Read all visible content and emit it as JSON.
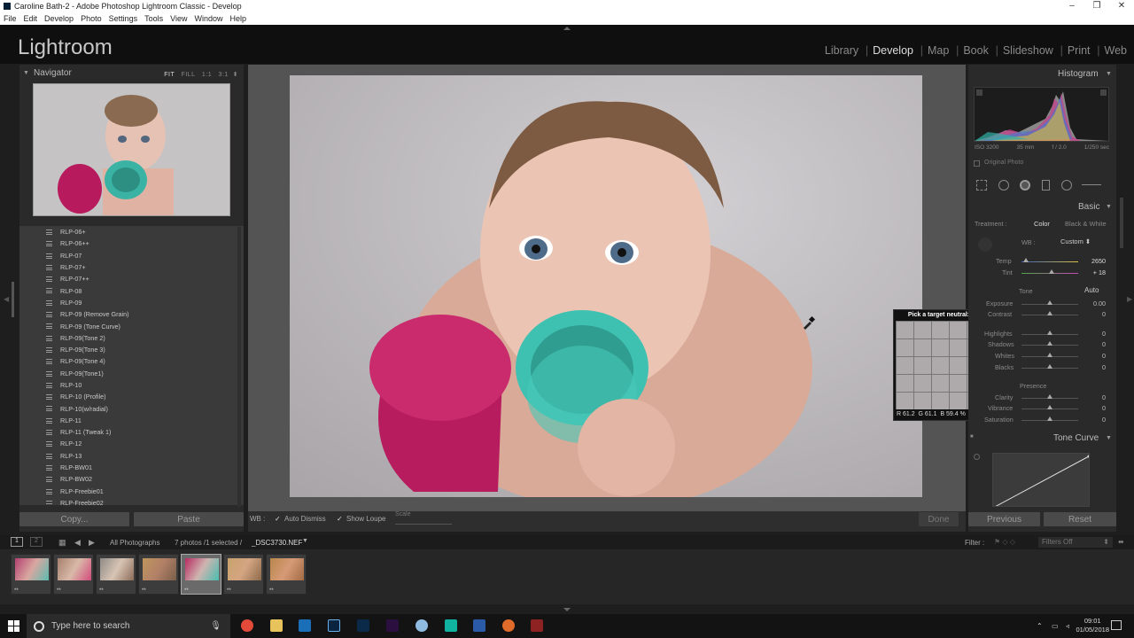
{
  "window": {
    "title": "Caroline Bath-2 - Adobe Photoshop Lightroom Classic - Develop"
  },
  "menu": [
    "File",
    "Edit",
    "Develop",
    "Photo",
    "Settings",
    "Tools",
    "View",
    "Window",
    "Help"
  ],
  "app": {
    "logo": "Lightroom",
    "modules": [
      "Library",
      "Develop",
      "Map",
      "Book",
      "Slideshow",
      "Print",
      "Web"
    ],
    "active_module": "Develop"
  },
  "navigator": {
    "title": "Navigator",
    "modes": [
      "FIT",
      "FILL",
      "1:1",
      "3:1"
    ],
    "active_mode": "FIT"
  },
  "presets": [
    "RLP-06+",
    "RLP-06++",
    "RLP-07",
    "RLP-07+",
    "RLP-07++",
    "RLP-08",
    "RLP-09",
    "RLP-09 (Remove Grain)",
    "RLP-09 (Tone Curve)",
    "RLP-09(Tone 2)",
    "RLP-09(Tone 3)",
    "RLP-09(Tone 4)",
    "RLP-09(Tone1)",
    "RLP-10",
    "RLP-10 (Profile)",
    "RLP-10(w/radial)",
    "RLP-11",
    "RLP-11 (Tweak 1)",
    "RLP-12",
    "RLP-13",
    "RLP-BW01",
    "RLP-BW02",
    "RLP-Freebie01",
    "RLP-Freebie02"
  ],
  "left_buttons": {
    "copy": "Copy...",
    "paste": "Paste"
  },
  "toolbar": {
    "wb": "WB :",
    "auto_dismiss": "Auto Dismiss",
    "show_loupe": "Show Loupe",
    "scale": "Scale",
    "done": "Done"
  },
  "histogram": {
    "title": "Histogram",
    "iso": "ISO 3200",
    "focal": "35 mm",
    "aperture": "f / 2.0",
    "shutter": "1/250 sec",
    "original": "Original Photo"
  },
  "basic": {
    "title": "Basic",
    "treatment_label": "Treatment :",
    "color": "Color",
    "bw": "Black & White",
    "wb_label": "WB :",
    "wb_value": "Custom",
    "temp_label": "Temp",
    "temp_value": "2650",
    "tint_label": "Tint",
    "tint_value": "+ 18",
    "tone_label": "Tone",
    "auto": "Auto",
    "exposure_label": "Exposure",
    "exposure_value": "0.00",
    "contrast_label": "Contrast",
    "contrast_value": "0",
    "highlights_label": "Highlights",
    "highlights_value": "0",
    "shadows_label": "Shadows",
    "shadows_value": "0",
    "whites_label": "Whites",
    "whites_value": "0",
    "blacks_label": "Blacks",
    "blacks_value": "0",
    "presence_label": "Presence",
    "clarity_label": "Clarity",
    "clarity_value": "0",
    "vibrance_label": "Vibrance",
    "vibrance_value": "0",
    "saturation_label": "Saturation",
    "saturation_value": "0"
  },
  "tone_curve": {
    "title": "Tone Curve"
  },
  "right_buttons": {
    "previous": "Previous",
    "reset": "Reset"
  },
  "loupe": {
    "title": "Pick a target neutral:",
    "r": "R 61.2",
    "g": "G 61.1",
    "b": "B 59.4",
    "pct": "%"
  },
  "filmstrip_bar": {
    "view1": "1",
    "view2": "2",
    "source": "All Photographs",
    "count": "7 photos /1 selected /",
    "filename": "_DSC3730.NEF",
    "filter_label": "Filter :",
    "filter_value": "Filters Off"
  },
  "filmstrip": {
    "stars": [
      "**",
      "**",
      "**",
      "**",
      "**",
      "**",
      "**"
    ],
    "selected_index": 4
  },
  "taskbar": {
    "search_placeholder": "Type here to search",
    "time": "09:01",
    "date": "01/05/2018"
  },
  "colors": {
    "accent": "#cccccc",
    "panel": "#2a2a2a",
    "center": "#545454"
  }
}
